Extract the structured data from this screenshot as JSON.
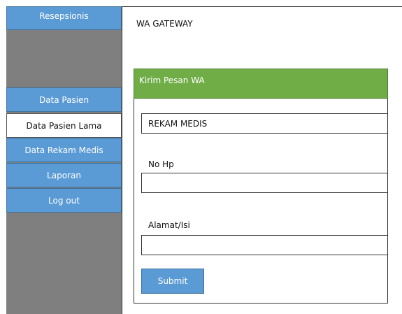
{
  "sidebar": {
    "title": "Resepsionis",
    "items": [
      {
        "label": "Data Pasien"
      },
      {
        "label": "Data Pasien Lama",
        "active": true
      },
      {
        "label": "Data Rekam Medis"
      },
      {
        "label": "Laporan"
      },
      {
        "label": "Log out"
      }
    ]
  },
  "header": {
    "title": "WA GATEWAY"
  },
  "panel": {
    "title": "Kirim Pesan WA",
    "field1_value": "REKAM MEDIS",
    "label_phone": "No Hp",
    "phone_value": "",
    "label_address": "Alamat/Isi",
    "address_value": "",
    "submit_label": "Submit"
  },
  "colors": {
    "nav_blue": "#5b9bd5",
    "sidebar_gray": "#7f7f7f",
    "panel_green": "#70ad47"
  }
}
